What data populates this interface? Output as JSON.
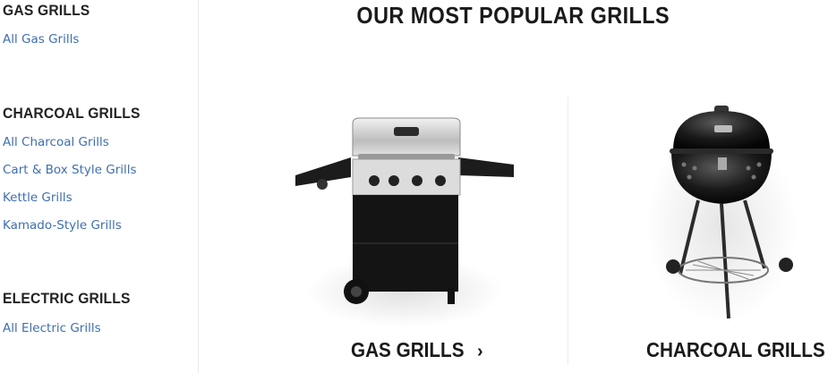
{
  "sidebar": {
    "sections": [
      {
        "title": "GAS GRILLS",
        "links": [
          "All Gas Grills"
        ]
      },
      {
        "title": "CHARCOAL GRILLS",
        "links": [
          "All Charcoal Grills",
          "Cart & Box Style Grills",
          "Kettle Grills",
          "Kamado-Style Grills"
        ]
      },
      {
        "title": "ELECTRIC GRILLS",
        "links": [
          "All Electric Grills"
        ]
      }
    ]
  },
  "main": {
    "title": "OUR MOST POPULAR GRILLS",
    "cards": [
      {
        "label": "GAS GRILLS",
        "chevron": "›",
        "image_icon": "gas-grill-image"
      },
      {
        "label": "CHARCOAL GRILLS",
        "chevron": "›",
        "image_icon": "kettle-grill-image"
      }
    ]
  },
  "colors": {
    "link": "#3f6fb0",
    "heading": "#222222",
    "divider": "#ececec"
  }
}
